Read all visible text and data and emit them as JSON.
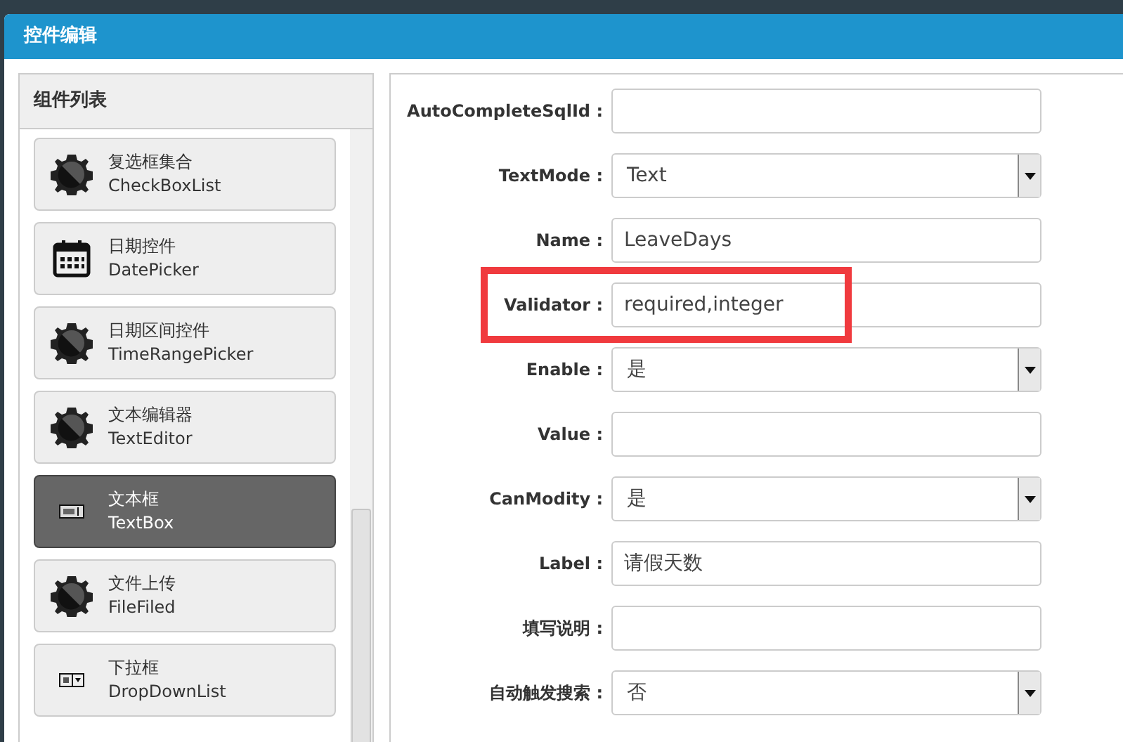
{
  "dialog": {
    "title": "控件编辑"
  },
  "component_list": {
    "title": "组件列表",
    "items": [
      {
        "name": "复选框集合",
        "type": "CheckBoxList",
        "kind": "gear",
        "selected": false
      },
      {
        "name": "日期控件",
        "type": "DatePicker",
        "kind": "calendar",
        "selected": false
      },
      {
        "name": "日期区间控件",
        "type": "TimeRangePicker",
        "kind": "gear",
        "selected": false
      },
      {
        "name": "文本编辑器",
        "type": "TextEditor",
        "kind": "gear",
        "selected": false
      },
      {
        "name": "文本框",
        "type": "TextBox",
        "kind": "textbox",
        "selected": true
      },
      {
        "name": "文件上传",
        "type": "FileFiled",
        "kind": "gear",
        "selected": false
      },
      {
        "name": "下拉框",
        "type": "DropDownList",
        "kind": "dropdown",
        "selected": false
      }
    ]
  },
  "properties": [
    {
      "label": "AutoCompleteSqlId :",
      "kind": "text",
      "highlighted": false
    },
    {
      "label": "TextMode :",
      "kind": "select",
      "value": "Text",
      "highlighted": false
    },
    {
      "label": "Name :",
      "kind": "text",
      "value": "LeaveDays",
      "highlighted": false
    },
    {
      "label": "Validator :",
      "kind": "text",
      "value": "required,integer",
      "highlighted": true
    },
    {
      "label": "Enable :",
      "kind": "select",
      "value": "是",
      "highlighted": false
    },
    {
      "label": "Value :",
      "kind": "text",
      "highlighted": false
    },
    {
      "label": "CanModity :",
      "kind": "select",
      "value": "是",
      "highlighted": false
    },
    {
      "label": "Label :",
      "kind": "text",
      "value": "请假天数",
      "highlighted": false
    },
    {
      "label": "填写说明 :",
      "kind": "text",
      "highlighted": false
    },
    {
      "label": "自动触发搜索 :",
      "kind": "select",
      "value": "否",
      "highlighted": false
    }
  ]
}
